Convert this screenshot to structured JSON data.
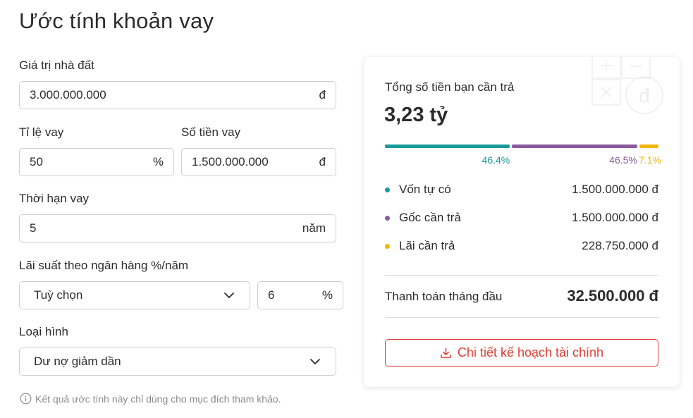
{
  "page": {
    "title": "Ước tính khoản vay"
  },
  "form": {
    "property_value": {
      "label": "Giá trị nhà đất",
      "value": "3.000.000.000",
      "unit": "đ"
    },
    "loan_ratio": {
      "label": "Tỉ lệ vay",
      "value": "50",
      "unit": "%"
    },
    "loan_amount": {
      "label": "Số tiền vay",
      "value": "1.500.000.000",
      "unit": "đ"
    },
    "loan_term": {
      "label": "Thời hạn vay",
      "value": "5",
      "unit": "năm"
    },
    "interest": {
      "label": "Lãi suất theo ngân hàng %/năm",
      "option": "Tuỳ chọn",
      "value": "6",
      "unit": "%"
    },
    "type": {
      "label": "Loại hình",
      "option": "Dư nợ giảm dần"
    },
    "note": "Kết quả ước tính này chỉ dùng cho mục đích tham khảo."
  },
  "summary": {
    "total_label": "Tổng số tiền bạn cần trả",
    "total_value": "3,23 tỷ",
    "breakdown": [
      {
        "name": "Vốn tự có",
        "value": "1.500.000.000 đ",
        "percent": "46.4%",
        "share": 46.4,
        "color": "#1a9a9a"
      },
      {
        "name": "Gốc cần trả",
        "value": "1.500.000.000 đ",
        "percent": "46.5%",
        "share": 46.5,
        "color": "#8a5a9e"
      },
      {
        "name": "Lãi cần trả",
        "value": "228.750.000 đ",
        "percent": "7.1%",
        "share": 7.1,
        "color": "#f2b705"
      }
    ],
    "monthly_label": "Thanh toán tháng đầu",
    "monthly_value": "32.500.000 đ",
    "detail_button": "Chi tiết kế hoạch tài chính"
  }
}
